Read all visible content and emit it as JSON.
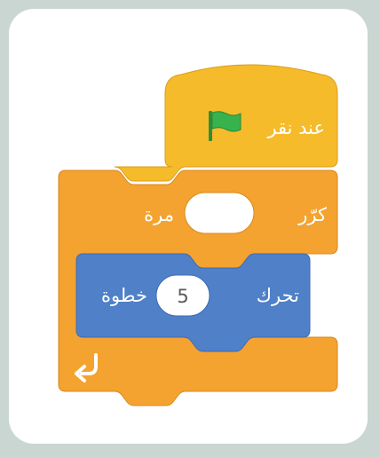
{
  "hat_block": {
    "label": "عند نقر",
    "flag_icon": "green-flag-icon",
    "color": "#f6bb2b"
  },
  "repeat_block": {
    "label_before": "كرّر",
    "times_value": "",
    "label_after": "مرة",
    "loop_icon": "loop-arrow-icon",
    "color": "#f4a230"
  },
  "move_block": {
    "label_before": "تحرك",
    "steps_value": "5",
    "label_after": "خطوة",
    "color": "#4f80c8"
  }
}
